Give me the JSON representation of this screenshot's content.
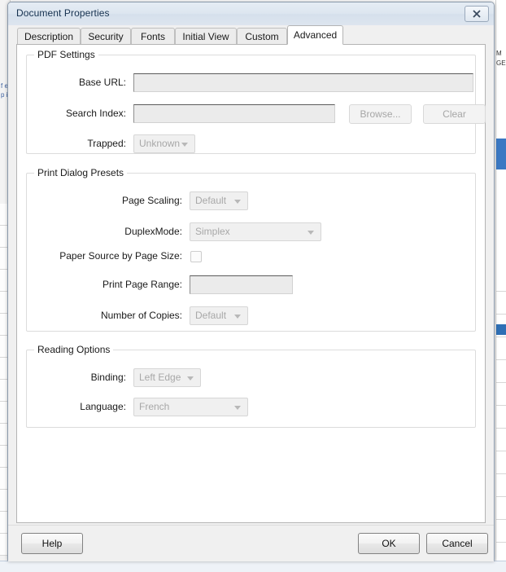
{
  "backdrop": {
    "left_text": "f e p il",
    "right_header": "M GE",
    "status_text": ""
  },
  "window": {
    "title": "Document Properties",
    "close_icon": "close-icon"
  },
  "tabs": [
    {
      "label": "Description",
      "active": false
    },
    {
      "label": "Security",
      "active": false
    },
    {
      "label": "Fonts",
      "active": false
    },
    {
      "label": "Initial View",
      "active": false
    },
    {
      "label": "Custom",
      "active": false
    },
    {
      "label": "Advanced",
      "active": true
    }
  ],
  "groups": {
    "pdf_settings": {
      "title": "PDF Settings",
      "base_url": {
        "label": "Base URL:",
        "value": "",
        "placeholder": ""
      },
      "search_index": {
        "label": "Search Index:",
        "value": "",
        "placeholder": ""
      },
      "browse_button": "Browse...",
      "clear_button": "Clear",
      "trapped": {
        "label": "Trapped:",
        "value": "Unknown"
      }
    },
    "print_dialog_presets": {
      "title": "Print Dialog Presets",
      "page_scaling": {
        "label": "Page Scaling:",
        "value": "Default"
      },
      "duplex_mode": {
        "label": "DuplexMode:",
        "value": "Simplex"
      },
      "paper_source": {
        "label": "Paper Source by Page Size:",
        "checked": false
      },
      "print_page_range": {
        "label": "Print Page Range:",
        "value": "",
        "placeholder": ""
      },
      "number_of_copies": {
        "label": "Number of Copies:",
        "value": "Default"
      }
    },
    "reading_options": {
      "title": "Reading Options",
      "binding": {
        "label": "Binding:",
        "value": "Left Edge"
      },
      "language": {
        "label": "Language:",
        "value": "French"
      }
    }
  },
  "footer": {
    "help_label": "Help",
    "ok_label": "OK",
    "cancel_label": "Cancel"
  },
  "colors": {
    "titlebar": "#dde6f0",
    "dialog_bg": "#f0f0f0",
    "panel_bg": "#ffffff",
    "disabled_text": "#a8a8a8",
    "accent_selection": "#3b78c3"
  }
}
